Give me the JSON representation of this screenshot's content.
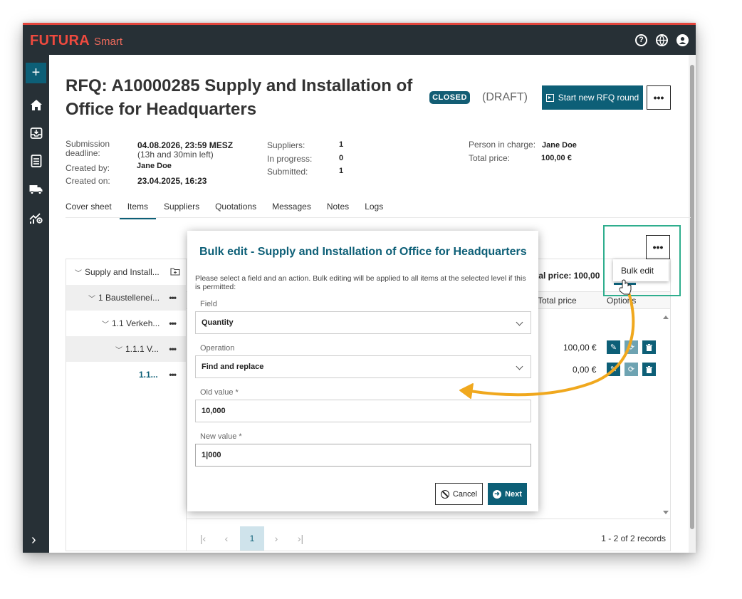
{
  "app": {
    "brand_main": "FUTURA",
    "brand_sub": "Smart"
  },
  "header_icons": [
    "help-icon",
    "globe-icon",
    "user-icon"
  ],
  "sidebar": {
    "items": [
      "add-icon",
      "home-icon",
      "inbox-icon",
      "checklist-icon",
      "truck-icon",
      "chart-gear-icon"
    ],
    "add_label": "+",
    "expand_label": "›"
  },
  "page": {
    "title": "RFQ: A10000285 Supply and Installation of Office for Headquarters",
    "status": "CLOSED",
    "draft": "(DRAFT)",
    "start_round": "Start new RFQ round",
    "more": "•••"
  },
  "meta": {
    "submission_deadline_label": "Submission deadline:",
    "submission_deadline_value": "04.08.2026, 23:59 MESZ",
    "submission_deadline_note": "(13h and 30min left)",
    "created_by_label": "Created by:",
    "created_by_value": "Jane Doe",
    "created_on_label": "Created on:",
    "created_on_value": "23.04.2025, 16:23",
    "suppliers_label": "Suppliers:",
    "suppliers_value": "1",
    "in_progress_label": "In progress:",
    "in_progress_value": "0",
    "submitted_label": "Submitted:",
    "submitted_value": "1",
    "person_label": "Person in charge:",
    "person_value": "Jane Doe",
    "total_label": "Total price:",
    "total_value": "100,00 €"
  },
  "tabs": [
    "Cover sheet",
    "Items",
    "Suppliers",
    "Quotations",
    "Messages",
    "Notes",
    "Logs"
  ],
  "active_tab": "Items",
  "tree": {
    "rows": [
      {
        "label": "Supply and Install...",
        "action": "add-folder-icon"
      },
      {
        "label": "1 Baustelleneí...",
        "action": "•••"
      },
      {
        "label": "1.1 Verkeh...",
        "action": "•••"
      },
      {
        "label": "1.1.1 V...",
        "action": "•••"
      },
      {
        "label": "1.1...",
        "action": "•••"
      }
    ]
  },
  "grid": {
    "total_price_top": "otal price: 100,00",
    "col_total": "Total price",
    "col_options": "Options",
    "rows": [
      {
        "total": "100,00 €"
      },
      {
        "total": "0,00 €"
      }
    ],
    "pager_current": "1",
    "records": "1 - 2 of 2 records",
    "more": "•••"
  },
  "context_menu": {
    "bulk_edit": "Bulk edit"
  },
  "modal": {
    "title": "Bulk edit - Supply and Installation of Office for Headquarters",
    "description": "Please select a field and an action. Bulk editing will be applied to all items at the selected level if this is permitted:",
    "field_label": "Field",
    "field_value": "Quantity",
    "operation_label": "Operation",
    "operation_value": "Find and replace",
    "old_label": "Old value *",
    "old_value": "10,000",
    "new_label": "New value *",
    "new_value": "1|000",
    "cancel": "Cancel",
    "next": "Next"
  },
  "colors": {
    "accent": "#0d5f77",
    "brand": "#ee4a3f",
    "topbar": "#273036",
    "highlight": "#2fae8e",
    "arrow": "#f0a81e"
  }
}
